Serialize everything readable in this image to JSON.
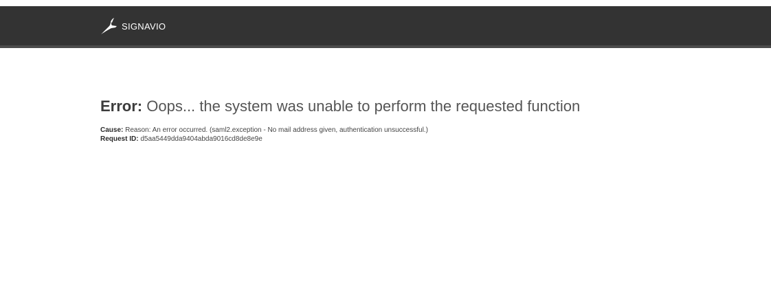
{
  "header": {
    "brand_name": "SIGNAVIO",
    "brand_icon": "signavio-gazelle-icon",
    "bar_color": "#333333"
  },
  "error": {
    "label": "Error:",
    "message": "Oops... the system was unable to perform the requested function",
    "cause_label": "Cause:",
    "cause_text": "Reason: An error occurred. (saml2.exception - No mail address given, authentication unsuccessful.)",
    "request_id_label": "Request ID:",
    "request_id_value": "d5aa5449dda9404abda9016cd8de8e9e"
  }
}
